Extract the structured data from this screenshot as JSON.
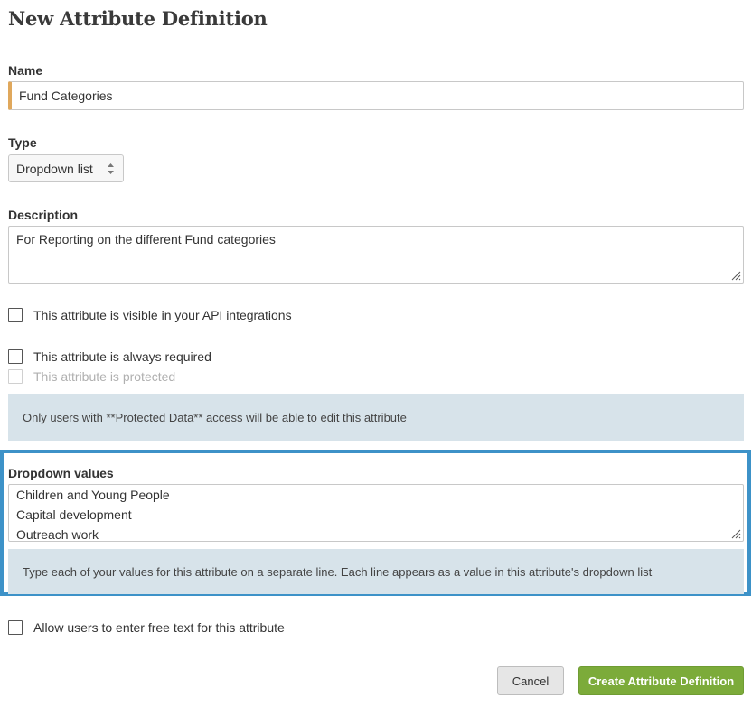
{
  "page": {
    "title": "New Attribute Definition"
  },
  "name_field": {
    "label": "Name",
    "value": "Fund Categories"
  },
  "type_field": {
    "label": "Type",
    "selected": "Dropdown list"
  },
  "description_field": {
    "label": "Description",
    "value": "For Reporting on the different Fund categories"
  },
  "options": {
    "api_visible": {
      "label": "This attribute is visible in your API integrations",
      "checked": false
    },
    "always_required": {
      "label": "This attribute is always required",
      "checked": false
    },
    "protected": {
      "label": "This attribute is protected",
      "checked": false,
      "disabled": true
    },
    "protected_note": "Only users with **Protected Data** access will be able to edit this attribute"
  },
  "dropdown_values": {
    "label": "Dropdown values",
    "items": [
      "Children and Young People",
      "Capital development",
      "Outreach work"
    ],
    "help_text": "Type each of your values for this attribute on a separate line. Each line appears as a value in this attribute's dropdown list"
  },
  "free_text": {
    "label": "Allow users to enter free text for this attribute",
    "checked": false
  },
  "actions": {
    "cancel": "Cancel",
    "create": "Create Attribute Definition"
  },
  "colors": {
    "highlight_border": "#3d92c8",
    "primary_button": "#7cab3a",
    "info_panel": "#d7e3ea",
    "required_marker": "#e0a85c"
  }
}
